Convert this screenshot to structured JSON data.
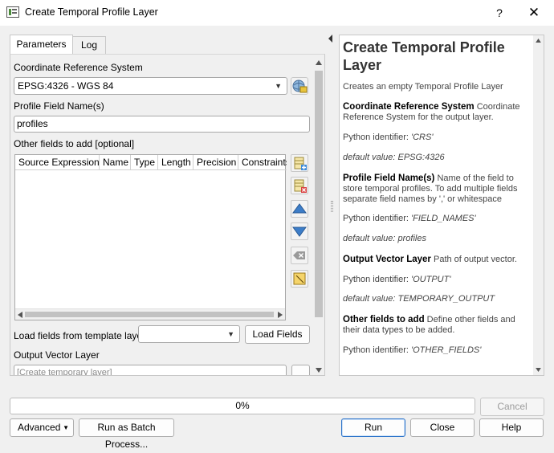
{
  "window": {
    "title": "Create Temporal Profile Layer",
    "help_glyph": "?",
    "close_glyph": "✕"
  },
  "tabs": [
    {
      "label": "Parameters",
      "active": true
    },
    {
      "label": "Log",
      "active": false
    }
  ],
  "params": {
    "crs_label": "Coordinate Reference System",
    "crs_value": "EPSG:4326 - WGS 84",
    "profile_label": "Profile Field Name(s)",
    "profile_value": "profiles",
    "other_fields_label": "Other fields to add [optional]",
    "table_columns": [
      "Source Expression",
      "Name",
      "Type",
      "Length",
      "Precision",
      "Constraints"
    ],
    "table_rows": [],
    "template_label": "Load fields from template layer",
    "template_value": "",
    "load_fields_button": "Load Fields",
    "output_label": "Output Vector Layer",
    "output_placeholder": "[Create temporary layer]"
  },
  "help": {
    "title": "Create Temporal Profile Layer",
    "summary": "Creates an empty Temporal Profile Layer",
    "sections": [
      {
        "name": "Coordinate Reference System",
        "desc": "Coordinate Reference System for the output layer.",
        "identifier_label": "Python identifier:",
        "identifier": "'CRS'",
        "default": "default value: EPSG:4326"
      },
      {
        "name": "Profile Field Name(s)",
        "desc": "Name of the field to store temporal profiles. To add multiple fields separate field names by ',' or whitespace",
        "identifier_label": "Python identifier:",
        "identifier": "'FIELD_NAMES'",
        "default": "default value: profiles"
      },
      {
        "name": "Output Vector Layer",
        "desc": "Path of output vector.",
        "identifier_label": "Python identifier:",
        "identifier": "'OUTPUT'",
        "default": "default value: TEMPORARY_OUTPUT"
      },
      {
        "name": "Other fields to add",
        "desc": "Define other fields and their data types to be added.",
        "identifier_label": "Python identifier:",
        "identifier": "'OTHER_FIELDS'",
        "default": ""
      }
    ]
  },
  "footer": {
    "progress_text": "0%",
    "progress_value": 0,
    "cancel_button": "Cancel",
    "advanced_button": "Advanced",
    "batch_button": "Run as Batch Process...",
    "run_button": "Run",
    "close_button": "Close",
    "help_button": "Help"
  }
}
